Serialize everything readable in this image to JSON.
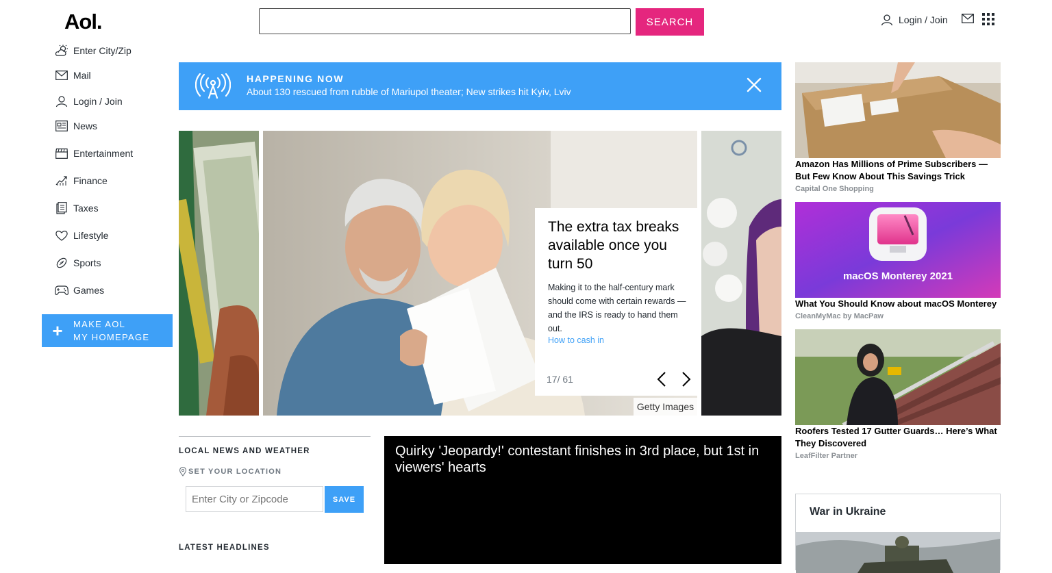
{
  "header": {
    "logo": "Aol.",
    "search_value": "",
    "search_button": "SEARCH",
    "login": "Login / Join"
  },
  "sidebar": {
    "items": [
      {
        "label": "Enter City/Zip",
        "icon": "weather-icon"
      },
      {
        "label": "Mail",
        "icon": "mail-icon"
      },
      {
        "label": "Login / Join",
        "icon": "user-icon"
      },
      {
        "label": "News",
        "icon": "newspaper-icon"
      },
      {
        "label": "Entertainment",
        "icon": "clapperboard-icon"
      },
      {
        "label": "Finance",
        "icon": "chart-icon"
      },
      {
        "label": "Taxes",
        "icon": "document-icon"
      },
      {
        "label": "Lifestyle",
        "icon": "heart-icon"
      },
      {
        "label": "Sports",
        "icon": "football-icon"
      },
      {
        "label": "Games",
        "icon": "gamepad-icon"
      }
    ],
    "homepage_line1": "MAKE AOL",
    "homepage_line2": "MY HOMEPAGE"
  },
  "banner": {
    "title": "HAPPENING NOW",
    "text": "About 130 rescued from rubble of Mariupol theater; New strikes hit Kyiv, Lviv"
  },
  "carousel": {
    "title": "The extra tax breaks available once you turn 50",
    "summary": "Making it to the half-century mark should come with certain rewards — and the IRS is ready to hand them out.",
    "link": "How to cash in",
    "counter": "17/ 61",
    "credit": "Getty Images"
  },
  "local": {
    "title": "LOCAL NEWS AND WEATHER",
    "set_location": "SET YOUR LOCATION",
    "zip_placeholder": "Enter City or Zipcode",
    "save": "SAVE",
    "latest": "LATEST HEADLINES"
  },
  "video": {
    "title": "Quirky 'Jeopardy!' contestant finishes in 3rd place, but 1st in viewers' hearts"
  },
  "ads": [
    {
      "title": "Amazon Has Millions of Prime Subscribers — But Few Know About This Savings Trick",
      "source": "Capital One Shopping"
    },
    {
      "title": "What You Should Know about macOS Monterey",
      "source": "CleanMyMac by MacPaw",
      "image_text": "macOS Monterey 2021"
    },
    {
      "title": "Roofers Tested 17 Gutter Guards… Here’s What They Discovered",
      "source": "LeafFilter Partner"
    }
  ],
  "ukraine": {
    "title": "War in Ukraine"
  },
  "colors": {
    "accent_pink": "#e5267e",
    "accent_blue": "#3ea0f7"
  }
}
